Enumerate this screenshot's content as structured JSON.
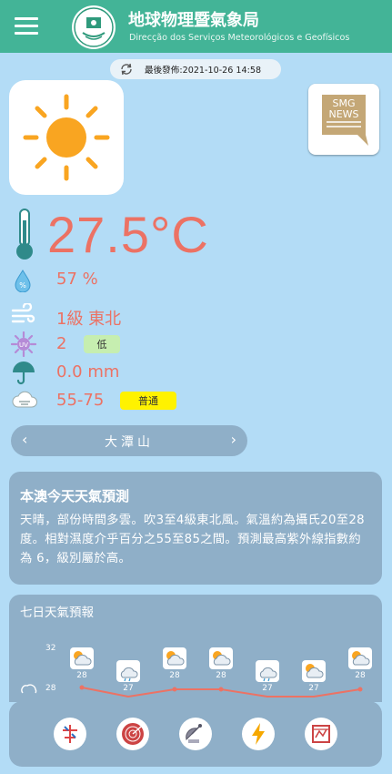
{
  "header": {
    "title": "地球物理暨氣象局",
    "subtitle": "Direcção dos Serviços Meteorológicos e Geofísicos"
  },
  "published": {
    "text": "最後發佈:2021-10-26 14:58"
  },
  "news": {
    "label_line1": "SMG",
    "label_line2": "NEWS"
  },
  "current": {
    "temperature": "27.5°C",
    "humidity": "57 %",
    "wind": "1級 東北",
    "uv_index": "2",
    "uv_level": "低",
    "rainfall": "0.0 mm",
    "air_quality": "55-75",
    "air_quality_level": "普通"
  },
  "location": {
    "prev": "‹",
    "name": "大潭山",
    "next": "›"
  },
  "forecast": {
    "title": "本澳今天天氣預測",
    "body": "天晴，部份時間多雲。吹3至4級東北風。氣溫約為攝氏20至28度。相對濕度介乎百分之55至85之間。預測最高紫外線指數約為 6，級別屬於高。"
  },
  "seven_day": {
    "title": "七日天氣預報",
    "axis": [
      "32",
      "28"
    ],
    "days": [
      {
        "icon": "sun-cloud-icon",
        "high": "28"
      },
      {
        "icon": "cloud-rain-icon",
        "high": "27"
      },
      {
        "icon": "sun-cloud-icon",
        "high": "28"
      },
      {
        "icon": "sun-cloud-icon",
        "high": "28"
      },
      {
        "icon": "cloud-rain-icon",
        "high": "27"
      },
      {
        "icon": "sun-cloud-icon",
        "high": "27"
      },
      {
        "icon": "sun-cloud-icon",
        "high": "28"
      }
    ]
  },
  "colors": {
    "header": "#43b497",
    "background": "#b3dcf6",
    "panel": "#8fafc8",
    "accent_red": "#ec7264",
    "badge_green": "#c6eeb0",
    "badge_yellow": "#fff200"
  },
  "tools": [
    "typhoon-icon",
    "radar-icon",
    "satellite-icon",
    "lightning-icon",
    "warning-map-icon"
  ]
}
